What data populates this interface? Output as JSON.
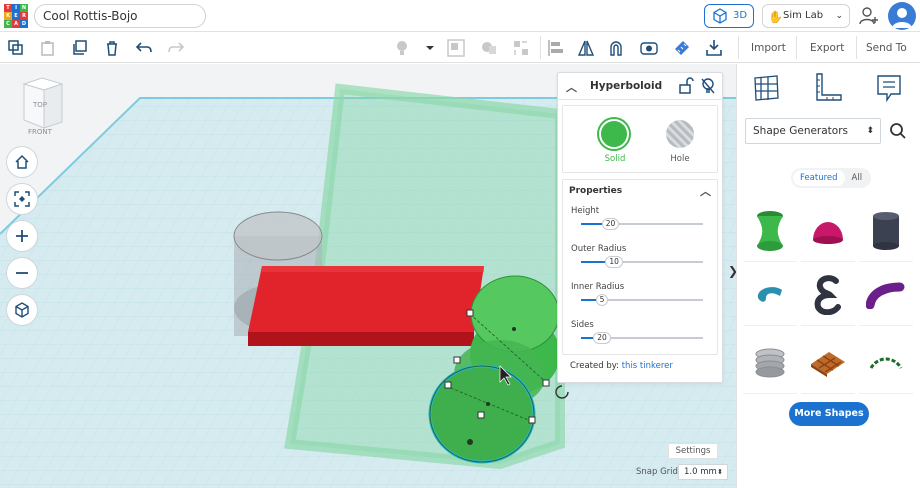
{
  "app": {
    "document_title": "Cool Rottis-Bojo",
    "logo_letters": [
      "T",
      "I",
      "N",
      "K",
      "E",
      "R",
      "C",
      "A",
      "D"
    ],
    "view_3d_label": "3D",
    "sim_lab_label": "Sim Lab",
    "brand_color": "#1c73cf"
  },
  "toolbar": {
    "import_label": "Import",
    "export_label": "Export",
    "send_to_label": "Send To"
  },
  "viewcube": {
    "top_label": "TOP",
    "front_label": "FRONT"
  },
  "inspector": {
    "shape_name": "Hyperboloid",
    "solid_label": "Solid",
    "hole_label": "Hole",
    "properties_label": "Properties",
    "properties": [
      {
        "label": "Height",
        "value": "20",
        "fraction": 0.17
      },
      {
        "label": "Outer Radius",
        "value": "10",
        "fraction": 0.2
      },
      {
        "label": "Inner Radius",
        "value": "5",
        "fraction": 0.12
      },
      {
        "label": "Sides",
        "value": "20",
        "fraction": 0.1
      }
    ],
    "created_by_label": "Created by:",
    "created_by_name": "this tinkerer",
    "solid_color": "#3db84b"
  },
  "workspace": {
    "settings_label": "Settings",
    "snap_grid_label": "Snap Grid",
    "snap_grid_value": "1.0 mm"
  },
  "sidebar": {
    "category_select": "Shape Generators",
    "tabs": [
      "Featured",
      "All"
    ],
    "active_tab": "Featured",
    "shapes": [
      "hyperboloid",
      "dome",
      "cylinder",
      "torus",
      "letter-e",
      "curved-tube",
      "spring-coil",
      "waffle",
      "arc-dashed"
    ],
    "more_shapes_label": "More Shapes"
  }
}
